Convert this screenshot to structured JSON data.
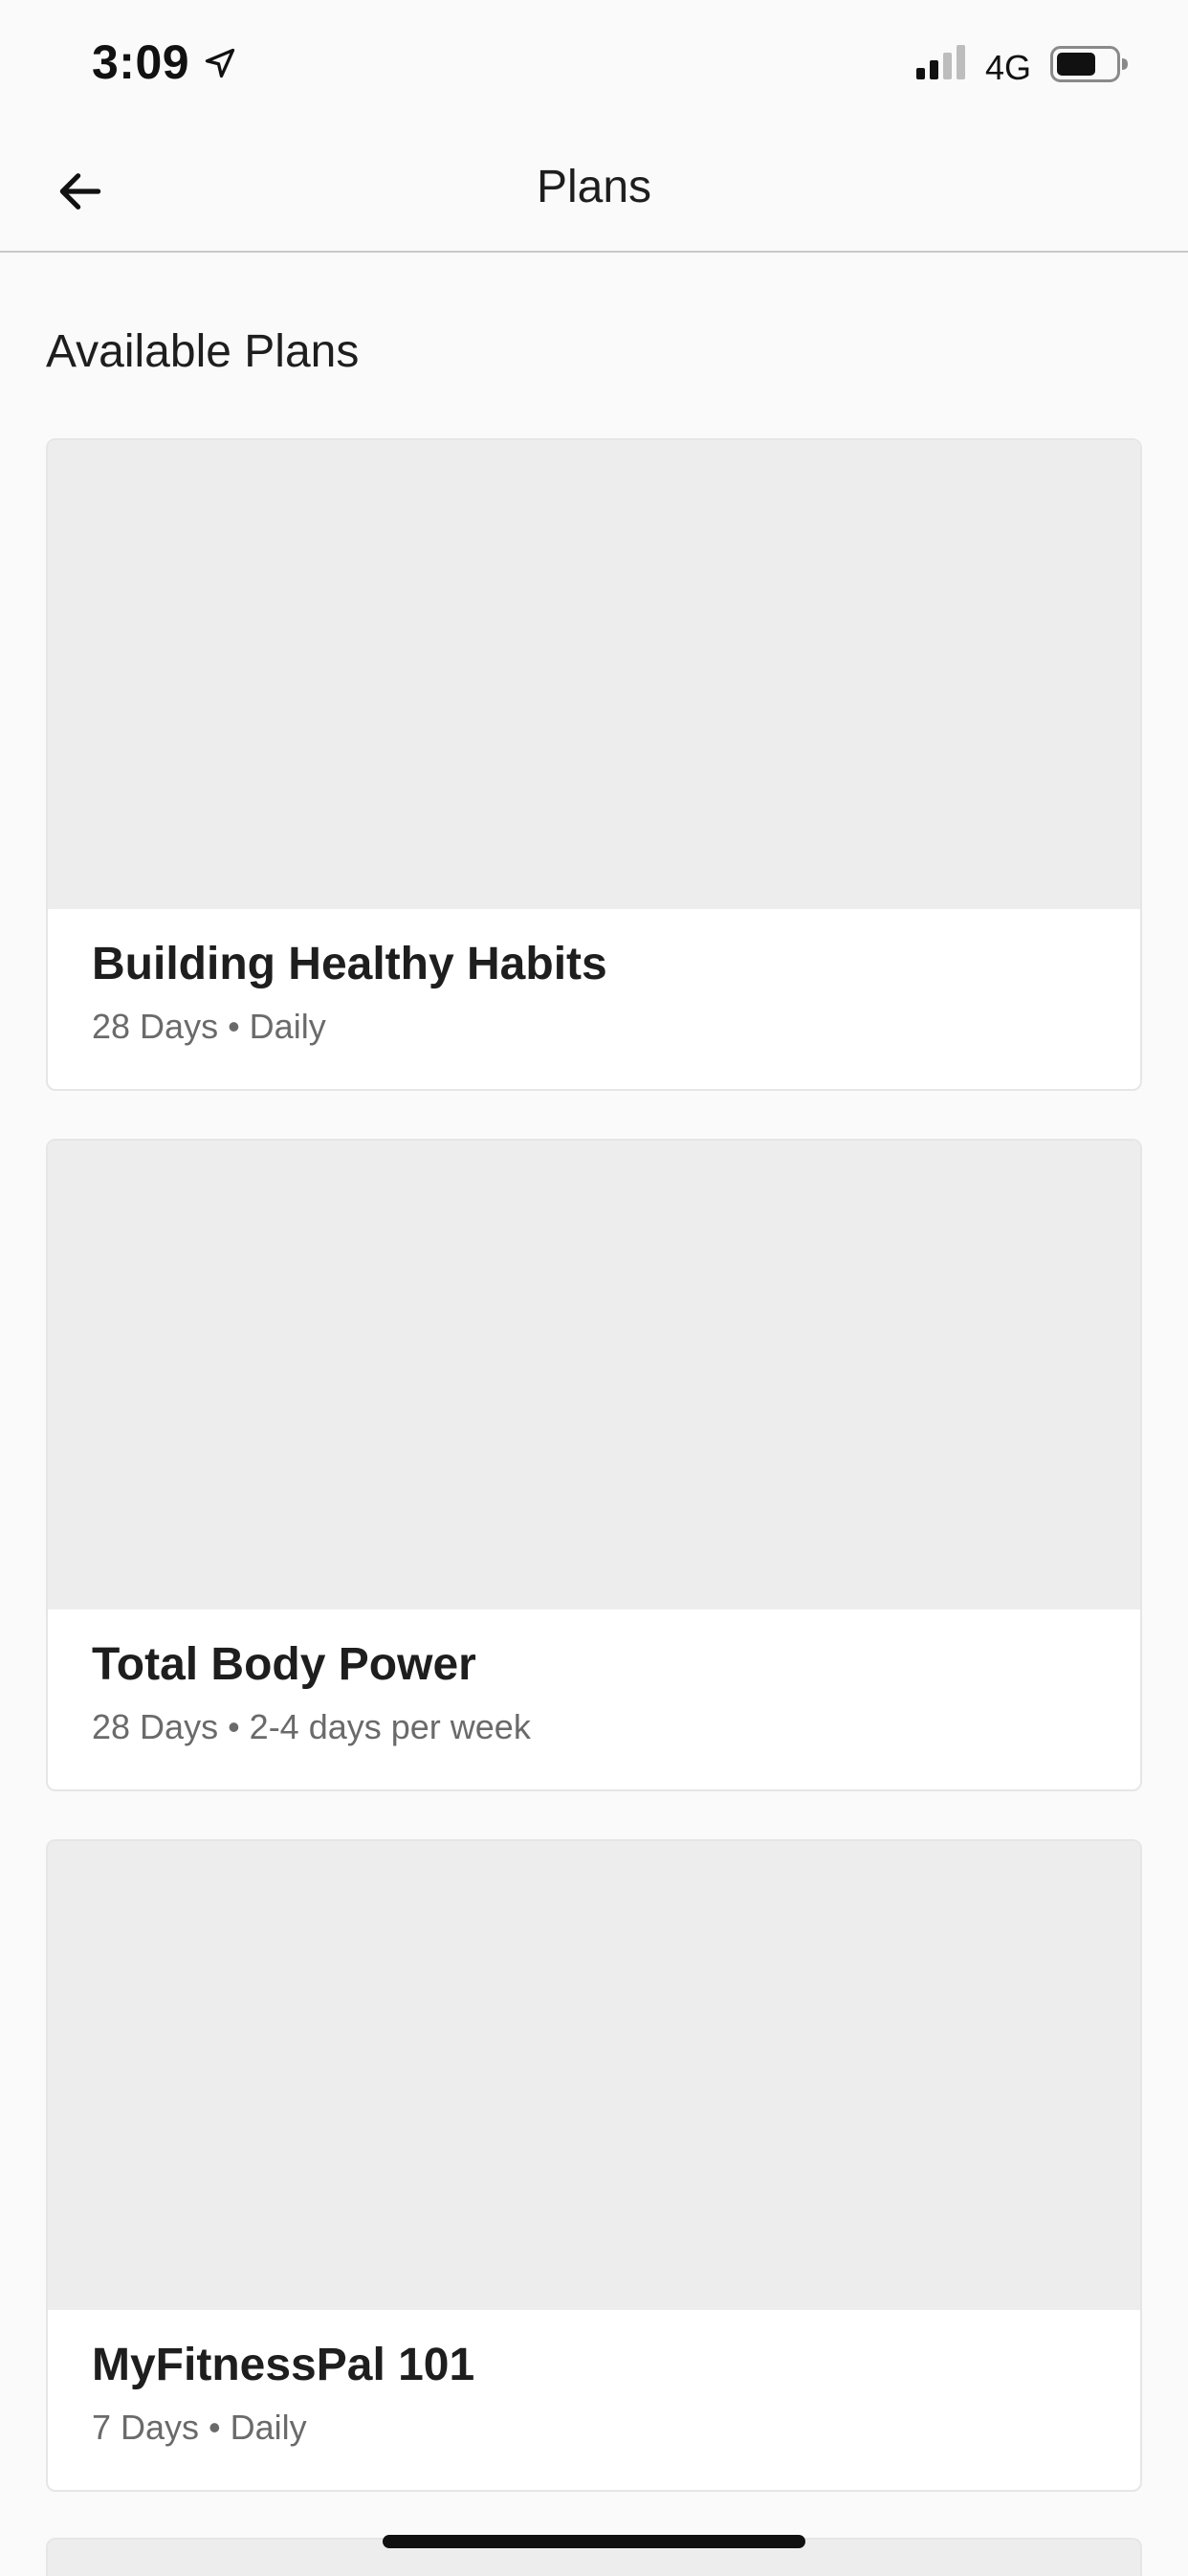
{
  "status_bar": {
    "time": "3:09",
    "network": "4G",
    "icons": [
      "location-arrow-icon",
      "signal-icon",
      "battery-icon"
    ]
  },
  "nav": {
    "title": "Plans",
    "back_icon": "arrow-left-icon"
  },
  "section": {
    "title": "Available Plans"
  },
  "plans": [
    {
      "name": "Building Healthy Habits",
      "meta": "28 Days • Daily"
    },
    {
      "name": "Total Body Power",
      "meta": "28 Days • 2-4 days per week"
    },
    {
      "name": "MyFitnessPal 101",
      "meta": "7 Days • Daily"
    }
  ],
  "colors": {
    "background": "#fafafa",
    "card": "#ffffff",
    "image_placeholder": "#ededed",
    "text_primary": "#1e1e1e",
    "text_secondary": "#6a6a6a"
  }
}
